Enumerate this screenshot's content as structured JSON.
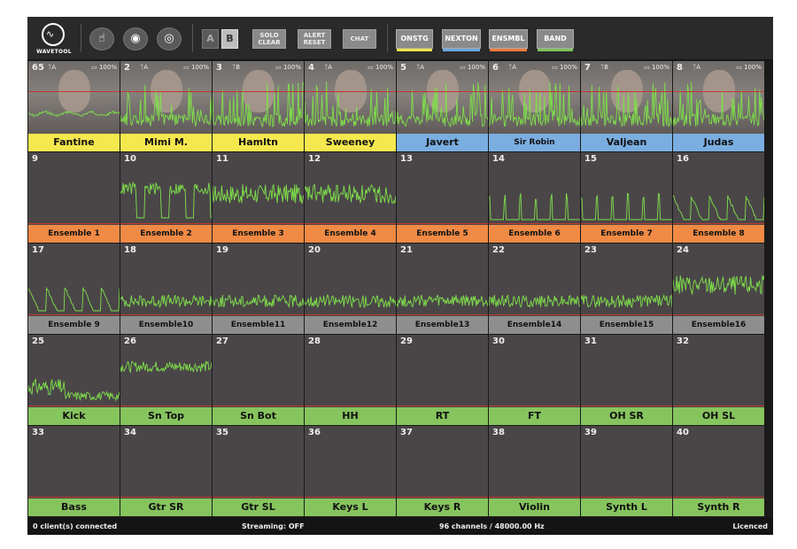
{
  "app": {
    "logo_text": "WAVETOOL"
  },
  "toolbar": {
    "icons": [
      "hand-touch-icon",
      "eye-icon",
      "hidden-eye-icon"
    ],
    "ab_a": "A",
    "ab_b": "B",
    "solo_clear_1": "SOLO",
    "solo_clear_2": "CLEAR",
    "alert_reset_1": "ALERT",
    "alert_reset_2": "RESET",
    "chat": "CHAT",
    "groups": [
      {
        "label": "ONSTG",
        "color": "#f2e24a"
      },
      {
        "label": "NEXTON",
        "color": "#6aa6e0"
      },
      {
        "label": "ENSMBL",
        "color": "#f07a3a"
      },
      {
        "label": "BAND",
        "color": "#7dc35a"
      }
    ]
  },
  "colors": {
    "yellow": "#f5e84e",
    "blue": "#7aaee0",
    "orange": "#f08a45",
    "gray": "#8e8e8e",
    "green": "#86c45e",
    "wave": "#7fe04a"
  },
  "channels": [
    {
      "num": "65",
      "meta": "ᛉA",
      "batt": "100%",
      "label": "Fantine",
      "group": "yellow",
      "photo": true,
      "wave": "flat"
    },
    {
      "num": "2",
      "meta": "ᛉA",
      "batt": "100%",
      "label": "Mimi M.",
      "group": "yellow",
      "photo": true,
      "wave": "spiky"
    },
    {
      "num": "3",
      "meta": "ᛉB",
      "batt": "100%",
      "label": "Hamltn",
      "group": "yellow",
      "photo": true,
      "wave": "spiky"
    },
    {
      "num": "4",
      "meta": "ᛉA",
      "batt": "100%",
      "label": "Sweeney",
      "group": "yellow",
      "photo": true,
      "wave": "spiky"
    },
    {
      "num": "5",
      "meta": "ᛉA",
      "batt": "100%",
      "label": "Javert",
      "group": "blue",
      "photo": true,
      "wave": "spiky"
    },
    {
      "num": "6",
      "meta": "ᛉA",
      "batt": "100%",
      "label": "Sir Robin",
      "group": "blue",
      "photo": true,
      "wave": "spiky"
    },
    {
      "num": "7",
      "meta": "ᛉB",
      "batt": "100%",
      "label": "Valjean",
      "group": "blue",
      "photo": true,
      "wave": "spiky"
    },
    {
      "num": "8",
      "meta": "ᛉA",
      "batt": "100%",
      "label": "Judas",
      "group": "blue",
      "photo": true,
      "wave": "spiky"
    },
    {
      "num": "9",
      "label": "Ensemble 1",
      "group": "orange",
      "wave": "none"
    },
    {
      "num": "10",
      "label": "Ensemble 2",
      "group": "orange",
      "wave": "square"
    },
    {
      "num": "11",
      "label": "Ensemble 3",
      "group": "orange",
      "wave": "dense"
    },
    {
      "num": "12",
      "label": "Ensemble 4",
      "group": "orange",
      "wave": "dense"
    },
    {
      "num": "13",
      "label": "Ensemble 5",
      "group": "orange",
      "wave": "none"
    },
    {
      "num": "14",
      "label": "Ensemble 6",
      "group": "orange",
      "wave": "pulses"
    },
    {
      "num": "15",
      "label": "Ensemble 7",
      "group": "orange",
      "wave": "pulses"
    },
    {
      "num": "16",
      "label": "Ensemble 8",
      "group": "orange",
      "wave": "decay"
    },
    {
      "num": "17",
      "label": "Ensemble 9",
      "group": "gray",
      "wave": "decay"
    },
    {
      "num": "18",
      "label": "Ensemble10",
      "group": "gray",
      "wave": "low"
    },
    {
      "num": "19",
      "label": "Ensemble11",
      "group": "gray",
      "wave": "low"
    },
    {
      "num": "20",
      "label": "Ensemble12",
      "group": "gray",
      "wave": "low"
    },
    {
      "num": "21",
      "label": "Ensemble13",
      "group": "gray",
      "wave": "low"
    },
    {
      "num": "22",
      "label": "Ensemble14",
      "group": "gray",
      "wave": "low"
    },
    {
      "num": "23",
      "label": "Ensemble15",
      "group": "gray",
      "wave": "low"
    },
    {
      "num": "24",
      "label": "Ensemble16",
      "group": "gray",
      "wave": "dense"
    },
    {
      "num": "25",
      "label": "Kick",
      "group": "green",
      "wave": "kick"
    },
    {
      "num": "26",
      "label": "Sn Top",
      "group": "green",
      "wave": "snare"
    },
    {
      "num": "27",
      "label": "Sn Bot",
      "group": "green",
      "wave": "none"
    },
    {
      "num": "28",
      "label": "HH",
      "group": "green",
      "wave": "none"
    },
    {
      "num": "29",
      "label": "RT",
      "group": "green",
      "wave": "none"
    },
    {
      "num": "30",
      "label": "FT",
      "group": "green",
      "wave": "none"
    },
    {
      "num": "31",
      "label": "OH SR",
      "group": "green",
      "wave": "none"
    },
    {
      "num": "32",
      "label": "OH SL",
      "group": "green",
      "wave": "none"
    },
    {
      "num": "33",
      "label": "Bass",
      "group": "green",
      "wave": "none"
    },
    {
      "num": "34",
      "label": "Gtr SR",
      "group": "green",
      "wave": "none"
    },
    {
      "num": "35",
      "label": "Gtr SL",
      "group": "green",
      "wave": "none"
    },
    {
      "num": "36",
      "label": "Keys L",
      "group": "green",
      "wave": "none"
    },
    {
      "num": "37",
      "label": "Keys R",
      "group": "green",
      "wave": "none"
    },
    {
      "num": "38",
      "label": "Violin",
      "group": "green",
      "wave": "none"
    },
    {
      "num": "39",
      "label": "Synth L",
      "group": "green",
      "wave": "none"
    },
    {
      "num": "40",
      "label": "Synth R",
      "group": "green",
      "wave": "none"
    }
  ],
  "status": {
    "clients": "0 client(s) connected",
    "streaming": "Streaming: OFF",
    "channels": "96 channels / 48000.00 Hz",
    "license": "Licenced"
  }
}
